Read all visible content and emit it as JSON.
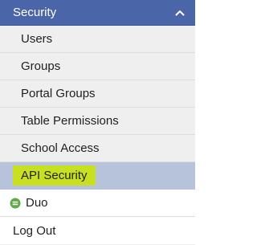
{
  "section": {
    "title": "Security",
    "toggle_icon": "chevron-up-icon"
  },
  "sub_items": [
    {
      "label": "Users"
    },
    {
      "label": "Groups"
    },
    {
      "label": "Portal Groups"
    },
    {
      "label": "Table Permissions"
    },
    {
      "label": "School Access"
    },
    {
      "label": "API Security",
      "active": true
    }
  ],
  "duo": {
    "label": "Duo",
    "icon": "duo-logo-icon",
    "icon_color": "#5faa47"
  },
  "logout": {
    "label": "Log Out"
  },
  "colors": {
    "header_bg": "#4b66a8",
    "active_bg": "#b7c3db",
    "highlight": "#c9e020",
    "item_bg": "#efefef"
  }
}
